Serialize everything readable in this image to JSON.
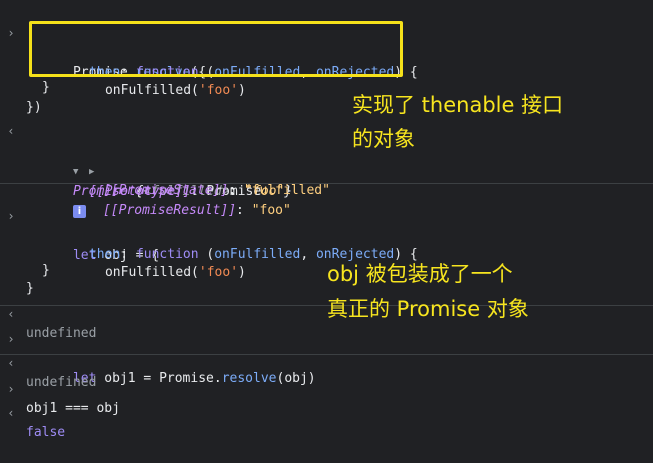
{
  "console": {
    "block1": {
      "l1_obj": "Promise",
      "l1_dot": ".",
      "l1_method": "resolve",
      "l1_rest": "({",
      "l2_key": "then",
      "l2_colon": ": ",
      "l2_fn": "function",
      "l2_paren_open": " (",
      "l2_param1": "onFulfilled",
      "l2_comma": ", ",
      "l2_param2": "onRejected",
      "l2_paren_close": ") {",
      "l3_call": "onFulfilled(",
      "l3_arg": "'foo'",
      "l3_close": ")",
      "l4": "}",
      "l5": "})"
    },
    "result1": {
      "label": "Promise",
      "brace_open": " {",
      "state_key": "<fulfilled>",
      "colon": ": ",
      "state_val": "\"foo\"",
      "brace_close": "}",
      "info_badge": "i",
      "proto_key": "[[Prototype]]",
      "proto_val": "Promise",
      "pstate_key": "[[PromiseState]]",
      "pstate_val": "\"fulfilled\"",
      "presult_key": "[[PromiseResult]]",
      "presult_val": "\"foo\""
    },
    "block2": {
      "kw": "let",
      "name": " obj = {",
      "l2_key": "then",
      "l2_colon": ": ",
      "l2_fn": "function",
      "l2_paren_open": " (",
      "l2_param1": "onFulfilled",
      "l2_comma": ", ",
      "l2_param2": "onRejected",
      "l2_paren_close": ") {",
      "l3_call": "onFulfilled(",
      "l3_arg": "'foo'",
      "l3_close": ")",
      "l4": "}",
      "l5": "}"
    },
    "undefined1": "undefined",
    "block3": {
      "kw": "let",
      "rest1": " obj1 = ",
      "obj": "Promise",
      "dot": ".",
      "method": "resolve",
      "rest2": "(obj)"
    },
    "undefined2": "undefined",
    "block4": {
      "expr": "obj1 === obj"
    },
    "false_result": "false"
  },
  "annotations": {
    "top_line1": "实现了 thenable 接口",
    "top_line2": "的对象",
    "mid_line1": "obj 被包装成了一个",
    "mid_line2": "真正的 Promise 对象"
  },
  "colors": {
    "background": "#202124",
    "highlight_box": "#f5e11a",
    "annotation_text": "#f7e51f",
    "keyword": "#9e8cf5",
    "property": "#7cacf8",
    "string": "#f28b54"
  },
  "icons": {
    "input_prompt": "chevron-right-icon",
    "output_return": "return-arrow-icon",
    "expand": "triangle-icon"
  }
}
